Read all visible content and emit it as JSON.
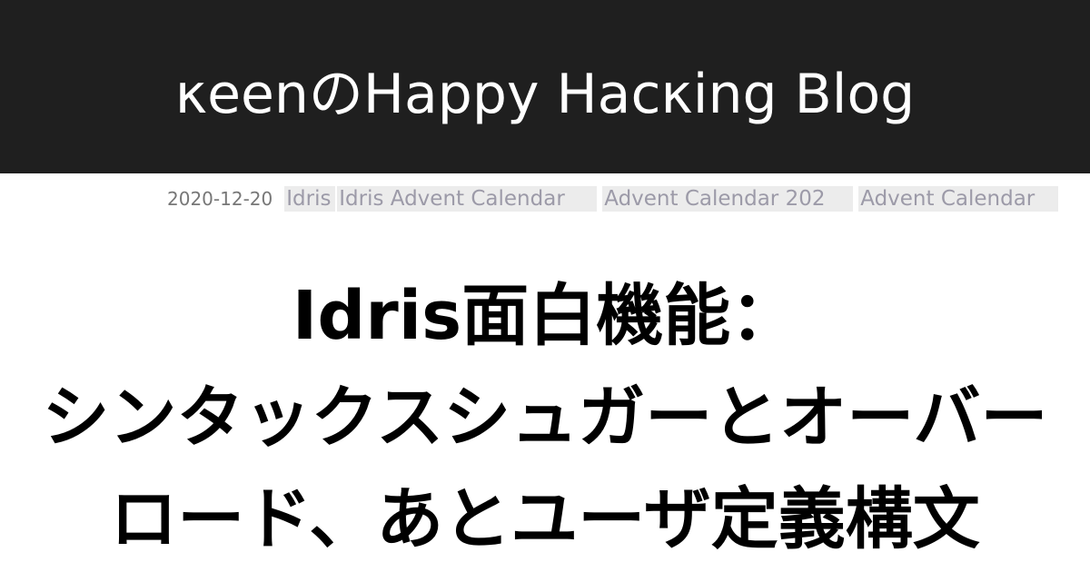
{
  "site": {
    "title": "κeenのHappy Hacκing Blog"
  },
  "post": {
    "date": "2020-12-20",
    "tags": [
      "Idris",
      "Idris Advent Calendar",
      "Advent Calendar 202",
      "Advent Calendar"
    ],
    "title_lines": [
      "Idris面白機能：",
      "シンタックスシュガーとオーバー",
      "ロード、あとユーザ定義構文"
    ]
  },
  "colors": {
    "header_background": "#1f1f1f",
    "header_text": "#ffffff",
    "tag_background": "#ececec",
    "tag_text": "#9c9aa8",
    "date_text": "#777777",
    "title_text": "#000000"
  }
}
